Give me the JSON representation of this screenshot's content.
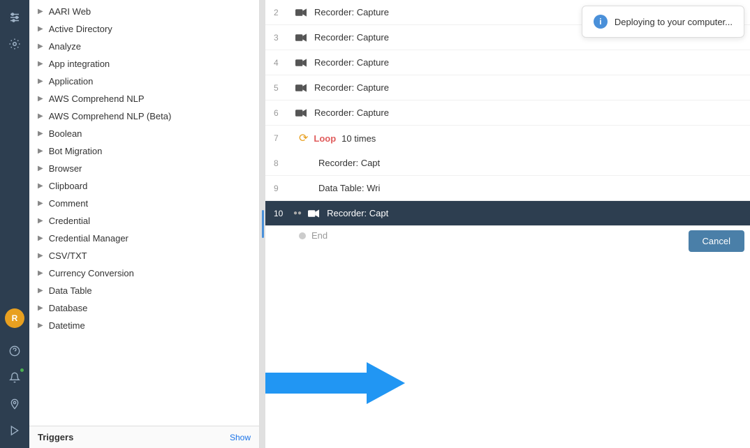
{
  "sidebar": {
    "icons": [
      {
        "name": "sliders-icon",
        "symbol": "⚙",
        "label": "Sliders",
        "active": false
      },
      {
        "name": "gear-icon",
        "symbol": "⚙",
        "label": "Settings",
        "active": false
      }
    ],
    "avatar": {
      "initials": "R",
      "name": "user-avatar"
    },
    "bottom_icons": [
      {
        "name": "question-icon",
        "symbol": "?"
      },
      {
        "name": "notification-icon",
        "symbol": "🔔"
      },
      {
        "name": "location-icon",
        "symbol": "📍"
      },
      {
        "name": "play-icon",
        "symbol": "▶"
      }
    ]
  },
  "packages": [
    {
      "id": 0,
      "label": "AARI Web",
      "indent": 0
    },
    {
      "id": 1,
      "label": "Active Directory",
      "indent": 0
    },
    {
      "id": 2,
      "label": "Analyze",
      "indent": 0
    },
    {
      "id": 3,
      "label": "App integration",
      "indent": 0
    },
    {
      "id": 4,
      "label": "Application",
      "indent": 0
    },
    {
      "id": 5,
      "label": "AWS Comprehend NLP",
      "indent": 0
    },
    {
      "id": 6,
      "label": "AWS Comprehend NLP (Beta)",
      "indent": 0
    },
    {
      "id": 7,
      "label": "Boolean",
      "indent": 0
    },
    {
      "id": 8,
      "label": "Bot Migration",
      "indent": 0
    },
    {
      "id": 9,
      "label": "Browser",
      "indent": 0
    },
    {
      "id": 10,
      "label": "Clipboard",
      "indent": 0
    },
    {
      "id": 11,
      "label": "Comment",
      "indent": 0
    },
    {
      "id": 12,
      "label": "Credential",
      "indent": 0
    },
    {
      "id": 13,
      "label": "Credential Manager",
      "indent": 0
    },
    {
      "id": 14,
      "label": "CSV/TXT",
      "indent": 0
    },
    {
      "id": 15,
      "label": "Currency Conversion",
      "indent": 0
    },
    {
      "id": 16,
      "label": "Data Table",
      "indent": 0
    },
    {
      "id": 17,
      "label": "Database",
      "indent": 0
    },
    {
      "id": 18,
      "label": "Datetime",
      "indent": 0
    }
  ],
  "triggers": {
    "label": "Triggers",
    "show_label": "Show"
  },
  "script_rows": [
    {
      "num": "2",
      "type": "recorder",
      "content": "Recorder: Capture",
      "truncated": true
    },
    {
      "num": "3",
      "type": "recorder",
      "content": "Recorder: Capture",
      "truncated": true
    },
    {
      "num": "4",
      "type": "recorder",
      "content": "Recorder: Capture",
      "truncated": true
    },
    {
      "num": "5",
      "type": "recorder",
      "content": "Recorder: Capture",
      "truncated": true
    },
    {
      "num": "6",
      "type": "recorder",
      "content": "Recorder: Capture",
      "truncated": true
    },
    {
      "num": "7",
      "type": "loop",
      "content": "Loop",
      "times": "10",
      "times_label": "times"
    },
    {
      "num": "8",
      "type": "recorder",
      "content": "Recorder: Capt",
      "truncated": true,
      "indent": true
    },
    {
      "num": "9",
      "type": "datatable",
      "content": "Data Table: Wri",
      "truncated": true,
      "indent": true
    },
    {
      "num": "10",
      "type": "recorder",
      "content": "Recorder: Capt",
      "truncated": true,
      "highlighted": true
    },
    {
      "num": "end",
      "type": "end",
      "content": "End"
    }
  ],
  "deploy": {
    "text": "Deploying to your computer...",
    "cancel_label": "Cancel"
  },
  "arrow": {
    "color": "#2196f3"
  }
}
